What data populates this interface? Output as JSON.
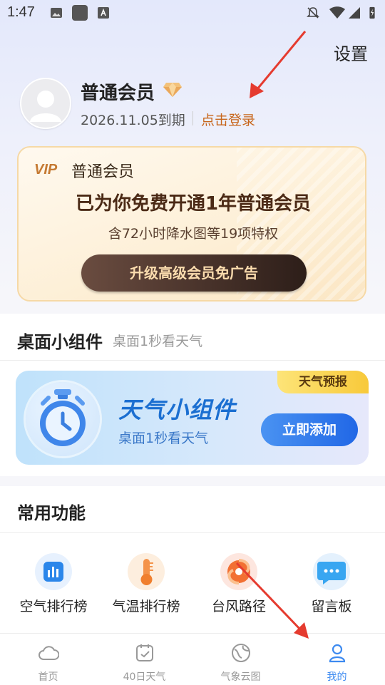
{
  "status_bar": {
    "time": "1:47"
  },
  "header": {
    "settings_label": "设置",
    "user_name": "普通会员",
    "expiry": "2026.11.05到期",
    "login_link": "点击登录"
  },
  "vip_card": {
    "logo": "VIP",
    "label": "普通会员",
    "title": "已为你免费开通1年普通会员",
    "subtitle": "含72小时降水图等19项特权",
    "button": "升级高级会员免广告"
  },
  "widget_section": {
    "title": "桌面小组件",
    "subtitle": "桌面1秒看天气",
    "card": {
      "title": "天气小组件",
      "subtitle": "桌面1秒看天气",
      "tag": "天气预报",
      "button": "立即添加"
    }
  },
  "common_section": {
    "title": "常用功能",
    "items": [
      {
        "label": "空气排行榜",
        "icon": "bar-chart-icon"
      },
      {
        "label": "气温排行榜",
        "icon": "thermometer-icon"
      },
      {
        "label": "台风路径",
        "icon": "typhoon-icon"
      },
      {
        "label": "留言板",
        "icon": "message-icon"
      }
    ]
  },
  "bottom_nav": [
    {
      "label": "首页",
      "icon": "cloud-icon",
      "active": false
    },
    {
      "label": "40日天气",
      "icon": "calendar-icon",
      "active": false
    },
    {
      "label": "气象云图",
      "icon": "globe-icon",
      "active": false
    },
    {
      "label": "我的",
      "icon": "person-icon",
      "active": true
    }
  ],
  "colors": {
    "accent_blue": "#3d8af0",
    "login_orange": "#c8661c",
    "annotation_red": "#e53b2f"
  }
}
